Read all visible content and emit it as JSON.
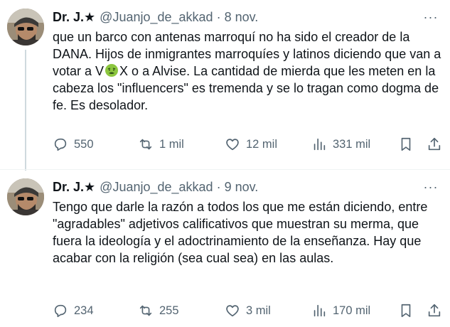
{
  "tweets": [
    {
      "author_name": "Dr. J.★",
      "handle": "@Juanjo_de_akkad",
      "separator": "·",
      "date": "8 nov.",
      "more_label": "···",
      "text_before_emoji": "que un barco con antenas marroquí no ha sido el creador de la DANA. Hijos de inmigrantes marroquíes y latinos diciendo que van a votar a V",
      "emoji": "nauseated-face",
      "text_after_emoji": "X o a Alvise. La cantidad de mierda que les meten en la cabeza los \"influencers\" es tremenda y se lo tragan como dogma de fe. Es desolador.",
      "replies": "550",
      "reposts": "1 mil",
      "likes": "12 mil",
      "views": "331 mil"
    },
    {
      "author_name": "Dr. J.★",
      "handle": "@Juanjo_de_akkad",
      "separator": "·",
      "date": "9 nov.",
      "more_label": "···",
      "text": "Tengo que darle la razón a todos los que me están diciendo, entre \"agradables\" adjetivos calificativos que muestran su merma, que fuera la ideología y el adoctrinamiento de la enseñanza. Hay que acabar con la religión (sea cual sea) en las aulas.",
      "replies": "234",
      "reposts": "255",
      "likes": "3 mil",
      "views": "170 mil"
    }
  ],
  "colors": {
    "text": "#0f1419",
    "secondary": "#536471",
    "thread_line": "#cfd9de",
    "divider": "#eff3f4"
  },
  "icons": [
    "reply-icon",
    "repost-icon",
    "like-icon",
    "views-icon",
    "bookmark-icon",
    "share-icon",
    "more-icon"
  ]
}
